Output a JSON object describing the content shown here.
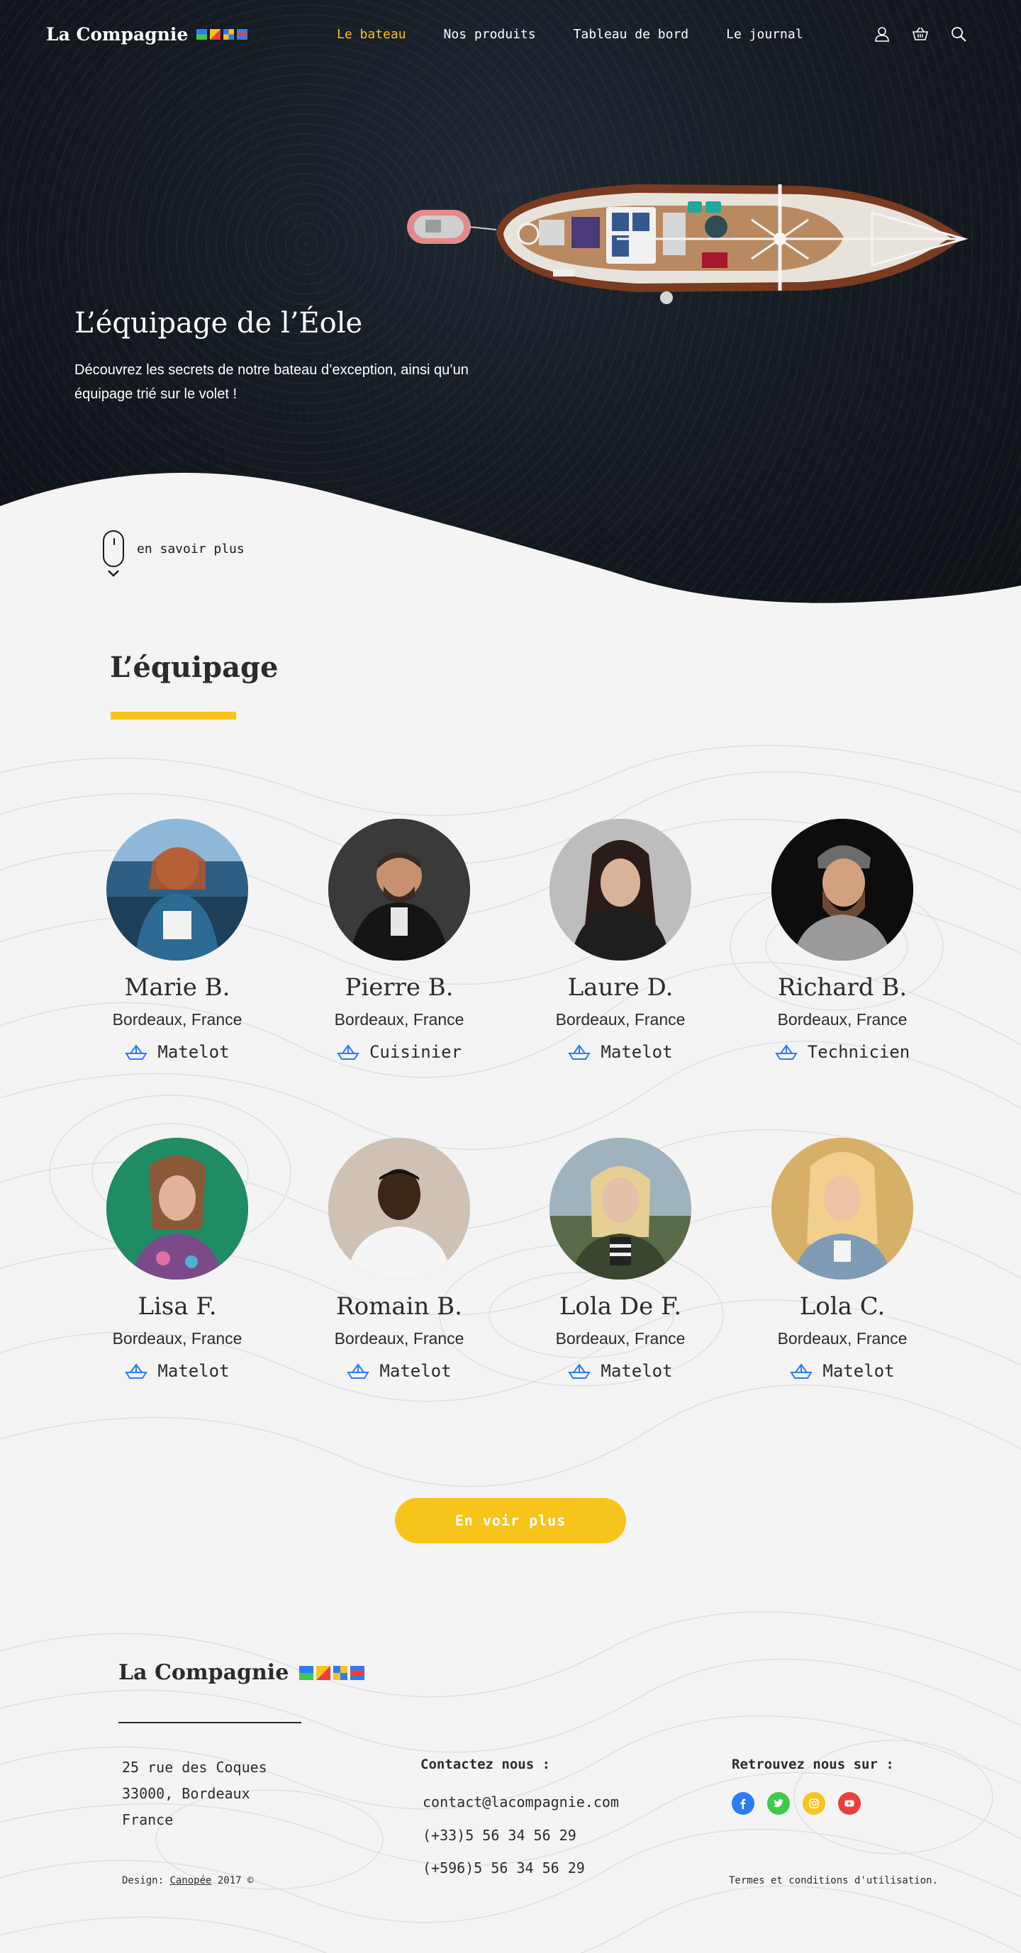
{
  "brand": {
    "name": "La Compagnie"
  },
  "nav": {
    "links": [
      "Le bateau",
      "Nos produits",
      "Tableau de bord",
      "Le journal"
    ],
    "active_index": 0,
    "icons": [
      "user-icon",
      "basket-icon",
      "search-icon"
    ]
  },
  "hero": {
    "title": "L’équipage de l’Éole",
    "subtitle": "Découvrez les secrets de notre bateau d’exception, ainsi qu’un équipage trié sur le volet !",
    "scroll_label": "en savoir plus"
  },
  "crew_section": {
    "title": "L’équipage",
    "members": [
      {
        "name": "Marie B.",
        "city": "Bordeaux, France",
        "role": "Matelot"
      },
      {
        "name": "Pierre B.",
        "city": "Bordeaux, France",
        "role": "Cuisinier"
      },
      {
        "name": "Laure D.",
        "city": "Bordeaux, France",
        "role": "Matelot"
      },
      {
        "name": "Richard B.",
        "city": "Bordeaux, France",
        "role": "Technicien"
      },
      {
        "name": "Lisa F.",
        "city": "Bordeaux, France",
        "role": "Matelot"
      },
      {
        "name": "Romain B.",
        "city": "Bordeaux, France",
        "role": "Matelot"
      },
      {
        "name": "Lola De F.",
        "city": "Bordeaux, France",
        "role": "Matelot"
      },
      {
        "name": "Lola C.",
        "city": "Bordeaux, France",
        "role": "Matelot"
      }
    ],
    "cta_label": "En voir plus"
  },
  "footer": {
    "brand": "La Compagnie",
    "address": [
      "25 rue des Coques",
      "33000, Bordeaux",
      "France"
    ],
    "contact_title": "Contactez nous :",
    "contact": [
      "contact@lacompagnie.com",
      "(+33)5 56 34 56 29",
      "(+596)5 56 34 56 29"
    ],
    "social_title": "Retrouvez nous sur :",
    "socials": [
      {
        "icon": "facebook-icon",
        "color": "#2d7bf4"
      },
      {
        "icon": "twitter-icon",
        "color": "#3ccb4a"
      },
      {
        "icon": "instagram-icon",
        "color": "#f7c41b"
      },
      {
        "icon": "youtube-icon",
        "color": "#e8413c"
      }
    ],
    "credit_prefix": "Design: ",
    "credit_link": "Canopée",
    "credit_suffix": " 2017 ©",
    "terms": "Termes et conditions d'utilisation."
  },
  "colors": {
    "accent": "#f7c41b",
    "icon_blue": "#2d7bf4",
    "flag_green": "#3ccb4a",
    "flag_red": "#e8413c"
  }
}
